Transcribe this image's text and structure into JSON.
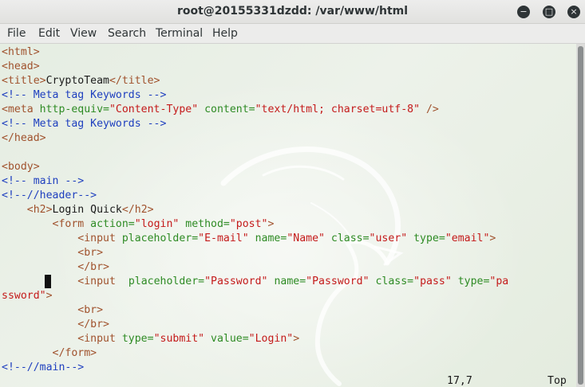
{
  "window": {
    "title": "root@20155331dzdd: /var/www/html",
    "minimize": "−",
    "maximize": "□",
    "close": "×"
  },
  "menu": [
    "File",
    "Edit",
    "View",
    "Search",
    "Terminal",
    "Help"
  ],
  "code_lines": [
    [
      {
        "t": "<html>",
        "c": "t"
      }
    ],
    [
      {
        "t": "<head>",
        "c": "t"
      }
    ],
    [
      {
        "t": "<title>",
        "c": "t"
      },
      {
        "t": "CryptoTeam",
        "c": ""
      },
      {
        "t": "</title>",
        "c": "t"
      }
    ],
    [
      {
        "t": "<!-- Meta tag Keywords -->",
        "c": "c"
      }
    ],
    [
      {
        "t": "<meta ",
        "c": "t"
      },
      {
        "t": "http-equiv=",
        "c": "a"
      },
      {
        "t": "\"Content-Type\"",
        "c": "s"
      },
      {
        "t": " content=",
        "c": "a"
      },
      {
        "t": "\"text/html; charset=utf-8\"",
        "c": "s"
      },
      {
        "t": " />",
        "c": "t"
      }
    ],
    [
      {
        "t": "<!-- Meta tag Keywords -->",
        "c": "c"
      }
    ],
    [
      {
        "t": "</head>",
        "c": "t"
      }
    ],
    [],
    [
      {
        "t": "<body>",
        "c": "t"
      }
    ],
    [
      {
        "t": "<!-- main -->",
        "c": "c"
      }
    ],
    [
      {
        "t": "<!--//header-->",
        "c": "c"
      }
    ],
    [
      {
        "t": "    ",
        "c": ""
      },
      {
        "t": "<h2>",
        "c": "t"
      },
      {
        "t": "Login Quick",
        "c": ""
      },
      {
        "t": "</h2>",
        "c": "t"
      }
    ],
    [
      {
        "t": "        ",
        "c": ""
      },
      {
        "t": "<form ",
        "c": "t"
      },
      {
        "t": "action=",
        "c": "a"
      },
      {
        "t": "\"login\"",
        "c": "s"
      },
      {
        "t": " method=",
        "c": "a"
      },
      {
        "t": "\"post\"",
        "c": "s"
      },
      {
        "t": ">",
        "c": "t"
      }
    ],
    [
      {
        "t": "            ",
        "c": ""
      },
      {
        "t": "<input ",
        "c": "t"
      },
      {
        "t": "placeholder=",
        "c": "a"
      },
      {
        "t": "\"E-mail\"",
        "c": "s"
      },
      {
        "t": " name=",
        "c": "a"
      },
      {
        "t": "\"Name\"",
        "c": "s"
      },
      {
        "t": " class=",
        "c": "a"
      },
      {
        "t": "\"user\"",
        "c": "s"
      },
      {
        "t": " type=",
        "c": "a"
      },
      {
        "t": "\"email\"",
        "c": "s"
      },
      {
        "t": ">",
        "c": "t"
      }
    ],
    [
      {
        "t": "            ",
        "c": ""
      },
      {
        "t": "<br>",
        "c": "t"
      }
    ],
    [
      {
        "t": "            ",
        "c": ""
      },
      {
        "t": "</br>",
        "c": "t"
      }
    ],
    [
      {
        "t": "            ",
        "c": ""
      },
      {
        "t": "<input  ",
        "c": "t"
      },
      {
        "t": "placeholder=",
        "c": "a"
      },
      {
        "t": "\"Password\"",
        "c": "s"
      },
      {
        "t": " name=",
        "c": "a"
      },
      {
        "t": "\"Password\"",
        "c": "s"
      },
      {
        "t": " class=",
        "c": "a"
      },
      {
        "t": "\"pass\"",
        "c": "s"
      },
      {
        "t": " type=",
        "c": "a"
      },
      {
        "t": "\"pa",
        "c": "s"
      }
    ],
    [
      {
        "t": "ssword\"",
        "c": "s"
      },
      {
        "t": ">",
        "c": "t"
      }
    ],
    [
      {
        "t": "            ",
        "c": ""
      },
      {
        "t": "<br>",
        "c": "t"
      }
    ],
    [
      {
        "t": "            ",
        "c": ""
      },
      {
        "t": "</br>",
        "c": "t"
      }
    ],
    [
      {
        "t": "            ",
        "c": ""
      },
      {
        "t": "<input ",
        "c": "t"
      },
      {
        "t": "type=",
        "c": "a"
      },
      {
        "t": "\"submit\"",
        "c": "s"
      },
      {
        "t": " value=",
        "c": "a"
      },
      {
        "t": "\"Login\"",
        "c": "s"
      },
      {
        "t": ">",
        "c": "t"
      }
    ],
    [
      {
        "t": "        ",
        "c": ""
      },
      {
        "t": "</form>",
        "c": "t"
      }
    ],
    [
      {
        "t": "<!--//main-->",
        "c": "c"
      }
    ]
  ],
  "status": {
    "position": "17,7",
    "scroll": "Top"
  }
}
